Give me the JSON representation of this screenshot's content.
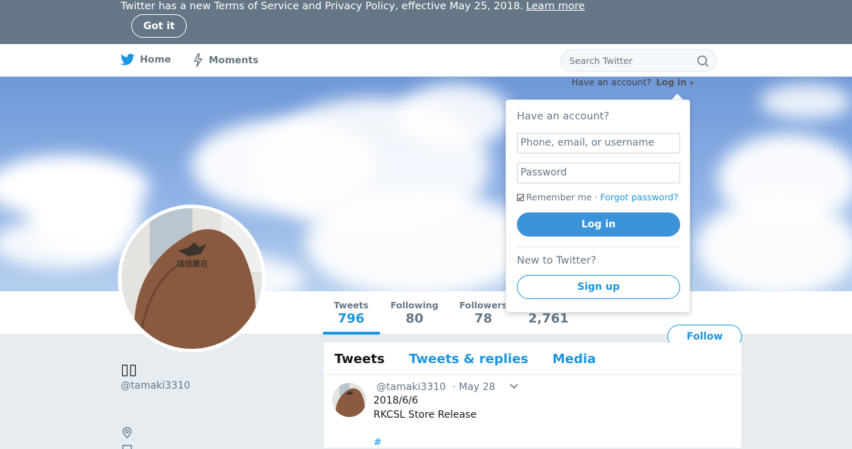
{
  "banner": {
    "text": "Twitter has a new Terms of Service and Privacy Policy, effective May 25, 2018.",
    "learn_more": "Learn more",
    "got_it": "Got it"
  },
  "nav": {
    "home": "Home",
    "moments": "Moments",
    "search_placeholder": "Search Twitter",
    "have_account": "Have an account?",
    "log_in": "Log in"
  },
  "login_dropdown": {
    "title": "Have an account?",
    "username_placeholder": "Phone, email, or username",
    "password_placeholder": "Password",
    "remember_me": "Remember me",
    "separator": "·",
    "forgot_password": "Forgot password?",
    "login_button": "Log in",
    "new_to_twitter": "New to Twitter?",
    "signup_button": "Sign up"
  },
  "profile": {
    "name": "▯▯",
    "handle": "@tamaki3310",
    "stats": [
      {
        "label": "Tweets",
        "value": "796"
      },
      {
        "label": "Following",
        "value": "80"
      },
      {
        "label": "Followers",
        "value": "78"
      },
      {
        "label": "",
        "value": "2,761"
      }
    ],
    "follow_button": "Follow"
  },
  "timeline": {
    "tabs": [
      "Tweets",
      "Tweets & replies",
      "Media"
    ],
    "tweet": {
      "handle": "@tamaki3310",
      "date": "· May 28",
      "line1": "2018/6/6",
      "line2": "RKCSL Store Release",
      "hashtag": "#"
    }
  },
  "colors": {
    "brand": "#1b95e0",
    "banner_bg": "#657786",
    "login_button": "#3b94d9"
  }
}
